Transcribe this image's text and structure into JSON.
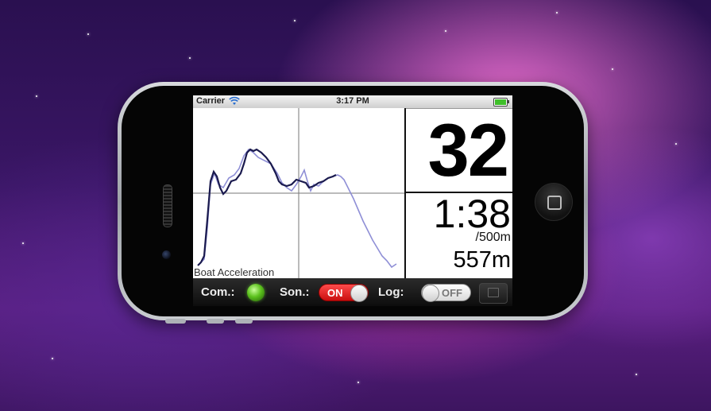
{
  "status_bar": {
    "carrier": "Carrier",
    "time": "3:17 PM"
  },
  "graph": {
    "label": "Boat Acceleration"
  },
  "metrics": {
    "stroke_rate": "32",
    "split_time": "1:38",
    "split_unit": "/500m",
    "distance": "557m"
  },
  "toolbar": {
    "com_label": "Com.:",
    "son_label": "Son.:",
    "son_toggle": "ON",
    "log_label": "Log:",
    "log_toggle": "OFF"
  },
  "colors": {
    "current_curve": "#1a1a4e",
    "previous_curve": "#8f8fd6",
    "led": "#5cc21d",
    "toggle_on": "#d91a1a"
  },
  "icons": [
    "wifi-icon",
    "battery-icon",
    "status-led-icon",
    "action-icon"
  ]
}
